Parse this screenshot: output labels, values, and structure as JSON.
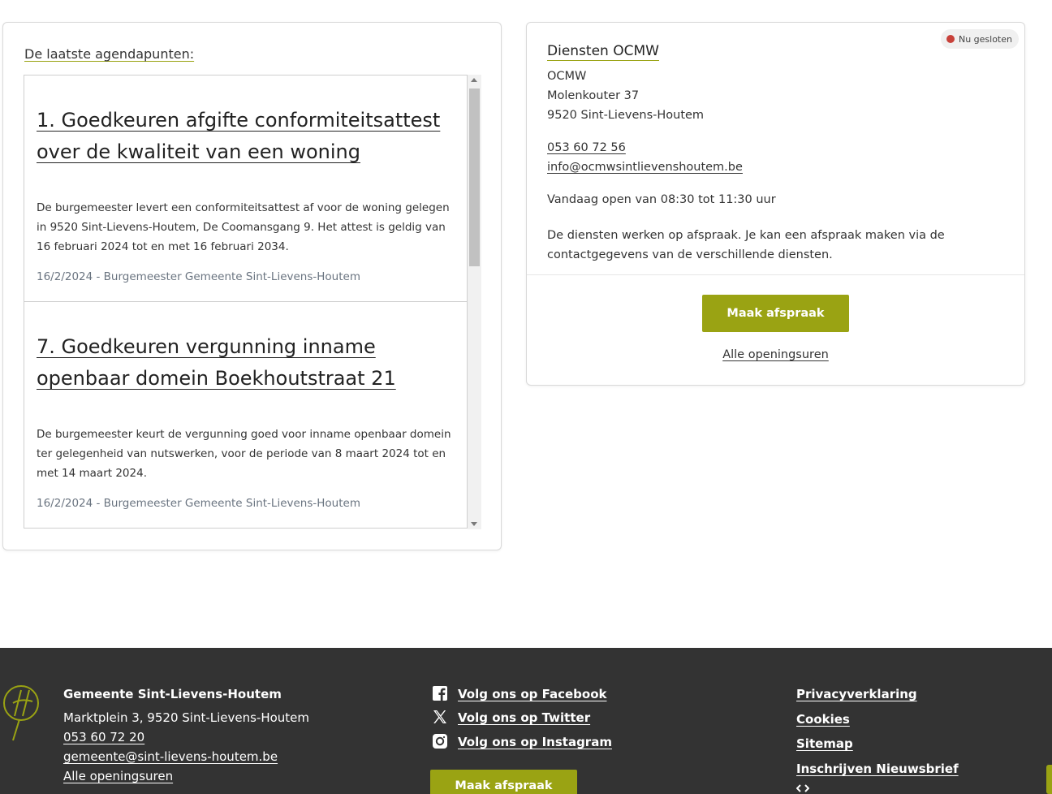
{
  "agenda": {
    "heading": "De laatste agendapunten:",
    "items": [
      {
        "title": "1. Goedkeuren afgifte conformiteitsattest over de kwaliteit van een woning",
        "description": "De burgemeester levert een conformiteitsattest af voor de woning gelegen in 9520 Sint-Lievens-Houtem, De Coomansgang 9. Het attest is geldig van 16 februari 2024 tot en met 16 februari 2034.",
        "meta": "16/2/2024 - Burgemeester Gemeente Sint-Lievens-Houtem"
      },
      {
        "title": "7. Goedkeuren vergunning inname openbaar domein Boekhoutstraat 21",
        "description": "De burgemeester keurt de vergunning goed voor inname openbaar domein ter gelegenheid van nutswerken, voor de periode van 8 maart 2024 tot en met 14 maart 2024.",
        "meta": "16/2/2024 - Burgemeester Gemeente Sint-Lievens-Houtem"
      }
    ]
  },
  "service": {
    "status": "Nu gesloten",
    "status_color": "#c8413a",
    "title": "Diensten OCMW",
    "org": "OCMW",
    "street": "Molenkouter 37",
    "city": "9520 Sint-Lievens-Houtem",
    "phone": "053 60 72 56",
    "email": "info@ocmwsintlievenshoutem.be",
    "hours_today": "Vandaag open van 08:30 tot 11:30 uur",
    "note": "De diensten werken op afspraak. Je kan een afspraak maken via de contactgegevens van de verschillende diensten.",
    "button": "Maak afspraak",
    "all_hours": "Alle openingsuren"
  },
  "footer": {
    "org_name": "Gemeente Sint-Lievens-Houtem",
    "address": "Marktplein 3, 9520 Sint-Lievens-Houtem",
    "phone": "053 60 72 20",
    "email": "gemeente@sint-lievens-houtem.be",
    "hours": "Alle openingsuren",
    "social": [
      {
        "icon": "facebook-icon",
        "label": "Volg ons op Facebook"
      },
      {
        "icon": "x-twitter-icon",
        "label": "Volg ons op Twitter"
      },
      {
        "icon": "instagram-icon",
        "label": "Volg ons op Instagram"
      }
    ],
    "button": "Maak afspraak",
    "links": [
      "Privacyverklaring",
      "Cookies",
      "Sitemap",
      "Inschrijven Nieuwsbrief"
    ]
  },
  "colors": {
    "accent": "#9aa313",
    "footer_bg": "#333333",
    "meta_text": "#6a7480"
  }
}
